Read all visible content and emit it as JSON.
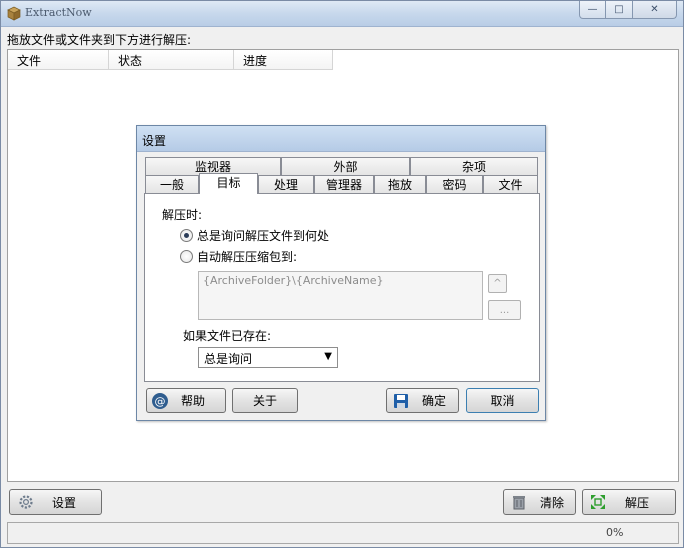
{
  "window": {
    "title": "ExtractNow",
    "minimize_glyph": "—",
    "maximize_glyph": "□",
    "close_glyph": "✕"
  },
  "main": {
    "hint": "拖放文件或文件夹到下方进行解压:",
    "columns": [
      "文件",
      "状态",
      "进度"
    ]
  },
  "bottom": {
    "settings_label": "设置",
    "clear_label": "清除",
    "extract_label": "解压",
    "progress_text": "0%"
  },
  "dialog": {
    "title": "设置",
    "tabs_row1": [
      "监视器",
      "外部",
      "杂项"
    ],
    "tabs_row2": [
      "一般",
      "目标",
      "处理",
      "管理器",
      "拖放",
      "密码",
      "文件"
    ],
    "active_tab": "目标",
    "extract_to_label": "解压时:",
    "option_ask": "总是询问解压文件到何处",
    "option_auto": "自动解压压缩包到:",
    "path_value": "{ArchiveFolder}\\{ArchiveName}",
    "path_up_glyph": "^",
    "path_browse_glyph": "...",
    "exists_label": "如果文件已存在:",
    "exists_selected": "总是询问",
    "help_label": "帮助",
    "about_label": "关于",
    "ok_label": "确定",
    "cancel_label": "取消"
  },
  "colors": {
    "title_text": "#4b5a6e",
    "accent_green": "#2e9e2e",
    "save_blue": "#1f5fa8"
  }
}
